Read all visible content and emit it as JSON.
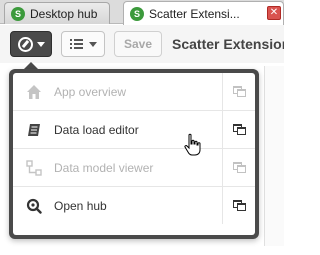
{
  "tabs": [
    {
      "label": "Desktop hub",
      "favicon": "S",
      "active": false
    },
    {
      "label": "Scatter Extensi...",
      "favicon": "S",
      "active": true,
      "close_glyph": "✕"
    }
  ],
  "toolbar": {
    "save_label": "Save",
    "app_title": "Scatter Extension"
  },
  "menu": {
    "items": [
      {
        "label": "App overview",
        "icon": "home-icon",
        "enabled": false
      },
      {
        "label": "Data load editor",
        "icon": "script-icon",
        "enabled": true
      },
      {
        "label": "Data model viewer",
        "icon": "data-model-icon",
        "enabled": false
      },
      {
        "label": "Open hub",
        "icon": "hub-search-icon",
        "enabled": true
      }
    ]
  },
  "colors": {
    "toolbar_dark": "#4a4a4a",
    "tab_close": "#d9534f",
    "favicon": "#3c9a3c",
    "disabled_text": "#b2b2b2"
  }
}
